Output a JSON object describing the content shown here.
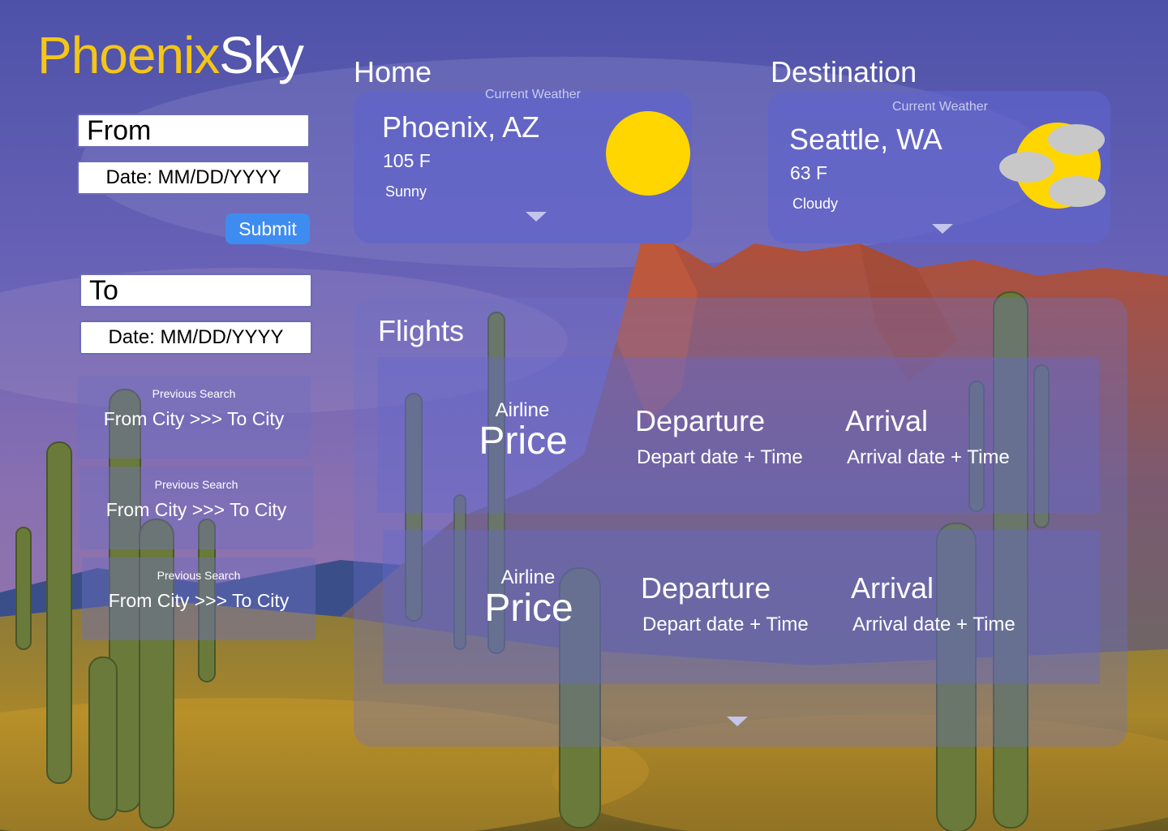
{
  "app": {
    "logo_part1": "Phoenix",
    "logo_part2": "Sky",
    "accent_color": "#f5c518"
  },
  "search": {
    "from_value": "From",
    "from_date": "Date: MM/DD/YYYY",
    "submit_label": "Submit",
    "to_value": "To",
    "to_date": "Date: MM/DD/YYYY",
    "submit_color": "#3f8cf0"
  },
  "previous_searches": [
    {
      "caption": "Previous Search",
      "route": "From City >>> To City"
    },
    {
      "caption": "Previous Search",
      "route": "From City >>> To City"
    },
    {
      "caption": "Previous Search",
      "route": "From City >>> To City"
    }
  ],
  "home": {
    "title": "Home",
    "caption": "Current Weather",
    "city": "Phoenix, AZ",
    "temp": "105 F",
    "condition": "Sunny",
    "icon": "sun-icon"
  },
  "destination": {
    "title": "Destination",
    "caption": "Current Weather",
    "city": "Seattle, WA",
    "temp": "63 F",
    "condition": "Cloudy",
    "icon": "cloudy-icon"
  },
  "flights": {
    "title": "Flights",
    "cards": [
      {
        "airline": "Airline",
        "price": "Price",
        "departure": "Departure",
        "depart_sub": "Depart date + Time",
        "arrival": "Arrival",
        "arrival_sub": "Arrival date + Time"
      },
      {
        "airline": "Airline",
        "price": "Price",
        "departure": "Departure",
        "depart_sub": "Depart date + Time",
        "arrival": "Arrival",
        "arrival_sub": "Arrival date + Time"
      }
    ]
  }
}
